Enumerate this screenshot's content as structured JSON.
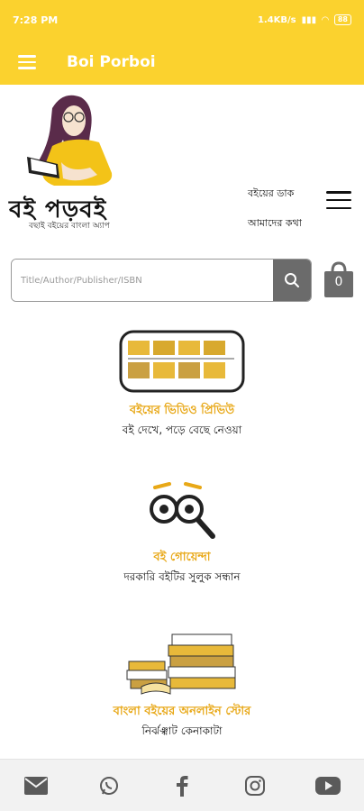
{
  "status_bar": {
    "time": "7:28 PM",
    "network_speed": "1.4KB/s",
    "battery": "88"
  },
  "app_bar": {
    "title": "Boi Porboi"
  },
  "brand": {
    "logo_text": "বই পড়বই",
    "tagline": "বছাই বইয়ের বাংলা অ্যাপ"
  },
  "top_links": {
    "link1": "বইয়ের ডাক",
    "link2": "আমাদের কথা"
  },
  "search": {
    "placeholder": "Title/Author/Publisher/ISBN"
  },
  "cart": {
    "count": "0"
  },
  "features": [
    {
      "title": "বইয়ের ভিডিও প্রিভিউ",
      "subtitle": "বই দেখে, পড়ে বেছে নেওয়া"
    },
    {
      "title": "বই গোয়েন্দা",
      "subtitle": "দরকারি বইটির সুলুক সন্ধান"
    },
    {
      "title": "বাংলা বইয়ের অনলাইন স্টোর",
      "subtitle": "নির্ঝঞ্ঝাট কেনাকাটা"
    }
  ],
  "colors": {
    "accent": "#fbd22e",
    "feature_title": "#e8a817"
  },
  "bottom_icons": [
    "mail-icon",
    "whatsapp-icon",
    "facebook-icon",
    "instagram-icon",
    "youtube-icon"
  ]
}
